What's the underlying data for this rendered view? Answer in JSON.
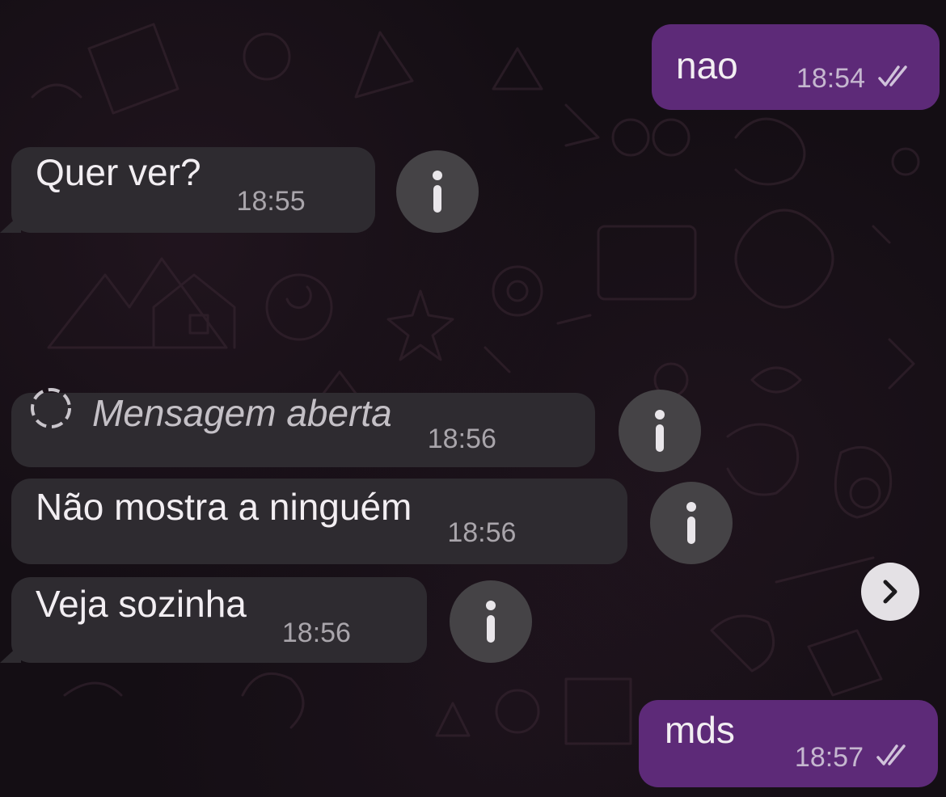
{
  "messages": [
    {
      "id": "m1",
      "direction": "outgoing",
      "text": "nao",
      "time": "18:54",
      "status": "read"
    },
    {
      "id": "m2",
      "direction": "incoming",
      "text": "Quer ver?",
      "time": "18:55"
    },
    {
      "id": "m3",
      "direction": "incoming",
      "text": "Mensagem aberta",
      "time": "18:56",
      "type": "view-once-opened"
    },
    {
      "id": "m4",
      "direction": "incoming",
      "text": "Não mostra a ninguém",
      "time": "18:56"
    },
    {
      "id": "m5",
      "direction": "incoming",
      "text": "Veja sozinha",
      "time": "18:56"
    },
    {
      "id": "m6",
      "direction": "outgoing",
      "text": "mds",
      "time": "18:57",
      "status": "read"
    }
  ],
  "icons": {
    "info": "info-icon",
    "view_once": "view-once-icon",
    "forward": "chevron-right-icon",
    "read_receipt": "double-check-icon"
  },
  "colors": {
    "incoming_bubble": "#2e2b30",
    "outgoing_bubble": "#5d2a78",
    "background": "#140e14",
    "info_button": "#454346"
  }
}
